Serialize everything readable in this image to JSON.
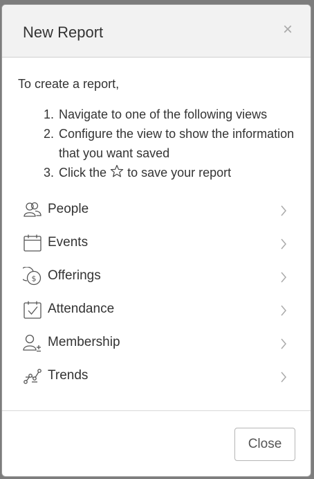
{
  "modal": {
    "title": "New Report",
    "close_symbol": "×",
    "intro": "To create a report,",
    "steps": [
      {
        "num": "1.",
        "text": "Navigate to one of the following views"
      },
      {
        "num": "2.",
        "text": "Configure the view to show the information that you want saved"
      },
      {
        "num": "3.",
        "text_before": "Click the",
        "icon": "star-icon",
        "text_after": "to save your report"
      }
    ],
    "views": [
      {
        "label": "People",
        "icon": "people-icon"
      },
      {
        "label": "Events",
        "icon": "calendar-icon"
      },
      {
        "label": "Offerings",
        "icon": "coins-icon"
      },
      {
        "label": "Attendance",
        "icon": "calendar-check-icon"
      },
      {
        "label": "Membership",
        "icon": "user-plus-minus-icon"
      },
      {
        "label": "Trends",
        "icon": "trend-line-icon"
      }
    ],
    "footer": {
      "close_label": "Close"
    }
  },
  "colors": {
    "header_bg": "#f2f2f2",
    "text": "#333333",
    "icon": "#555555",
    "chevron": "#aaaaaa"
  }
}
